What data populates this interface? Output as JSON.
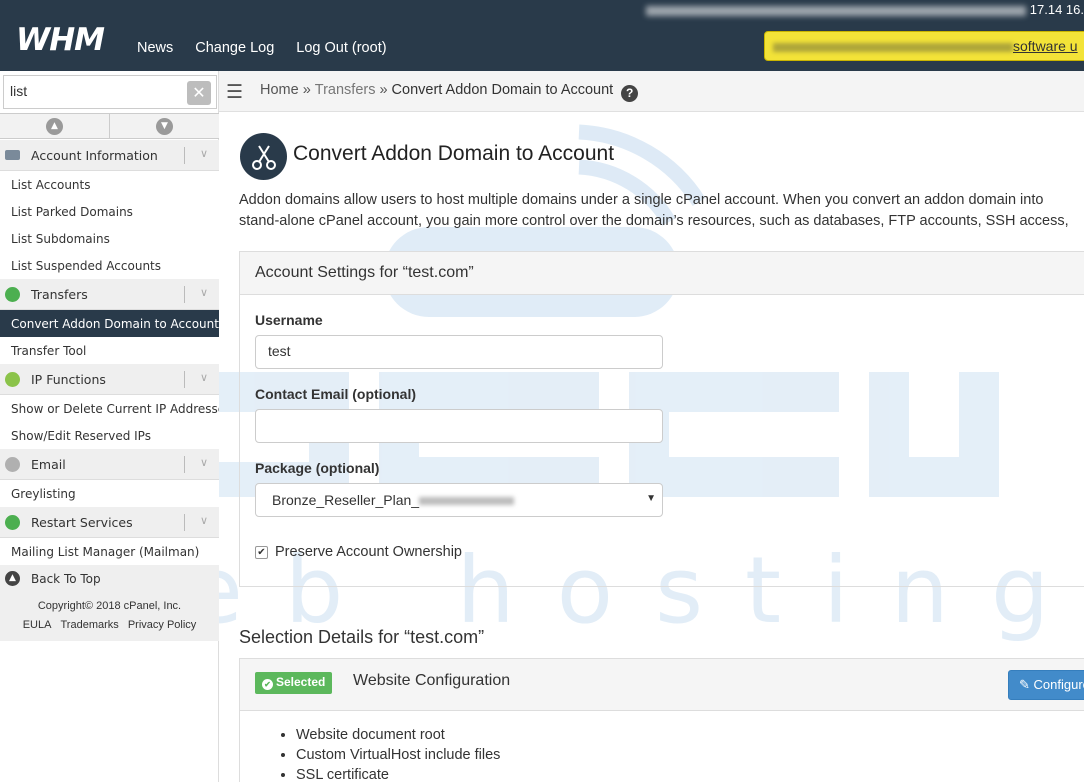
{
  "header": {
    "logo": "WHM",
    "nav": [
      "News",
      "Change Log",
      "Log Out (root)"
    ],
    "server_time": "17.14 16.",
    "notice_link": "software u"
  },
  "sidebar": {
    "search_value": "list",
    "groups": [
      {
        "label": "Account Information",
        "color": "#7a8a9a",
        "items": [
          "List Accounts",
          "List Parked Domains",
          "List Subdomains",
          "List Suspended Accounts"
        ]
      },
      {
        "label": "Transfers",
        "color": "#4caf50",
        "items": [
          "Convert Addon Domain to Account",
          "Transfer Tool"
        ]
      },
      {
        "label": "IP Functions",
        "color": "#8bc34a",
        "items": [
          "Show or Delete Current IP Addresses",
          "Show/Edit Reserved IPs"
        ]
      },
      {
        "label": "Email",
        "color": "#9e9e9e",
        "items": [
          "Greylisting"
        ]
      },
      {
        "label": "Restart Services",
        "color": "#4caf50",
        "items": [
          "Mailing List Manager (Mailman)"
        ]
      }
    ],
    "active_item": "Convert Addon Domain to Account",
    "back_to_top": "Back To Top",
    "copyright": "Copyright© 2018",
    "copyright_link": "cPanel, Inc.",
    "footer_links": [
      "EULA",
      "Trademarks",
      "Privacy Policy"
    ]
  },
  "breadcrumb": {
    "home": "Home",
    "transfers": "Transfers",
    "current": "Convert Addon Domain to Account",
    "sep": "»"
  },
  "main": {
    "title": "Convert Addon Domain to Account",
    "intro_line1": "Addon domains allow users to host multiple domains under a single cPanel account. When you convert an addon domain into",
    "intro_line2": "stand-alone cPanel account, you gain more control over the domain’s resources, such as databases, FTP accounts, SSH access,",
    "account_settings_title": "Account Settings for “test.com”",
    "username_label": "Username",
    "username_value": "test",
    "email_label": "Contact Email (optional)",
    "email_value": "",
    "package_label": "Package (optional)",
    "package_value": "Bronze_Reseller_Plan_",
    "preserve_label": "Preserve Account Ownership",
    "selection_title": "Selection Details for “test.com”",
    "selected_badge": "Selected",
    "website_config_title": "Website Configuration",
    "configure_button": "Configure",
    "bullets": [
      "Website document root",
      "Custom VirtualHost include files",
      "SSL certificate"
    ]
  },
  "watermark": {
    "text": "web hosting",
    "color": "#cfe0f0"
  }
}
